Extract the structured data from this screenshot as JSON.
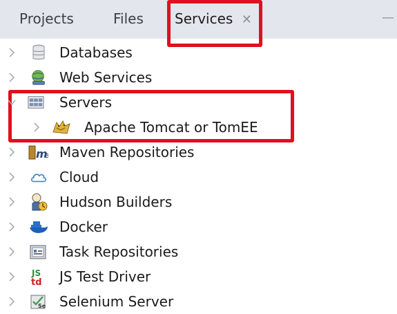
{
  "tabs": [
    {
      "label": "Projects"
    },
    {
      "label": "Files"
    },
    {
      "label": "Services",
      "active": true
    }
  ],
  "tree": {
    "items": [
      {
        "label": "Databases",
        "icon": "database-icon"
      },
      {
        "label": "Web Services",
        "icon": "web-services-icon"
      },
      {
        "label": "Servers",
        "icon": "servers-icon",
        "expanded": true
      },
      {
        "label": "Apache Tomcat or TomEE",
        "icon": "tomcat-icon"
      },
      {
        "label": "Maven Repositories",
        "icon": "maven-icon"
      },
      {
        "label": "Cloud",
        "icon": "cloud-icon"
      },
      {
        "label": "Hudson Builders",
        "icon": "hudson-icon"
      },
      {
        "label": "Docker",
        "icon": "docker-icon"
      },
      {
        "label": "Task Repositories",
        "icon": "task-repositories-icon"
      },
      {
        "label": "JS Test Driver",
        "icon": "js-test-driver-icon"
      },
      {
        "label": "Selenium Server",
        "icon": "selenium-icon"
      }
    ]
  },
  "colors": {
    "highlight": "#e0101e",
    "tabbar": "#e3e6ec"
  }
}
